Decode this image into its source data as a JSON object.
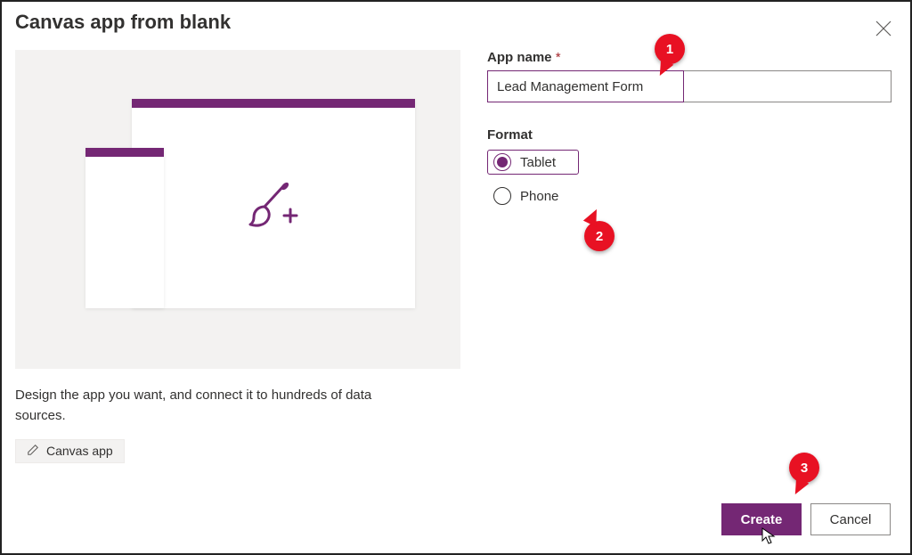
{
  "dialog": {
    "title": "Canvas app from blank",
    "description": "Design the app you want, and connect it to hundreds of data sources.",
    "tag_label": "Canvas app"
  },
  "form": {
    "app_name_label": "App name",
    "required_marker": "*",
    "app_name_value": "Lead Management Form",
    "format_label": "Format",
    "options": {
      "tablet": "Tablet",
      "phone": "Phone"
    },
    "selected": "tablet"
  },
  "buttons": {
    "create": "Create",
    "cancel": "Cancel"
  },
  "annotations": {
    "c1": "1",
    "c2": "2",
    "c3": "3"
  },
  "colors": {
    "accent": "#742774",
    "callout": "#e81123"
  }
}
